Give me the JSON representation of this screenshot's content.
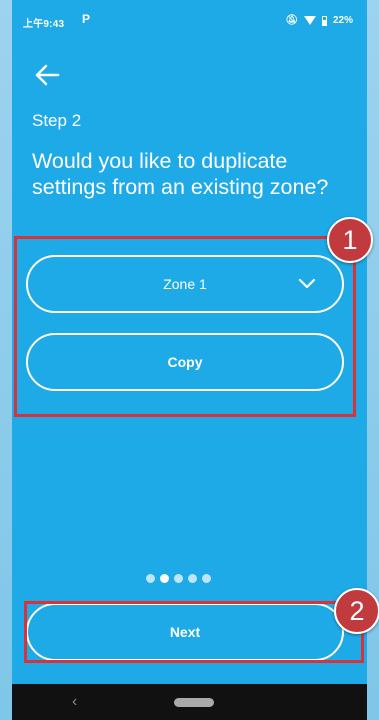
{
  "status": {
    "time": "上午9:43",
    "app_icon": "P",
    "battery": "22%",
    "icons": [
      "mute-icon",
      "wifi-icon",
      "battery-icon"
    ]
  },
  "header": {
    "back_icon": "arrow-left-icon"
  },
  "content": {
    "step": "Step 2",
    "question": "Would you like to duplicate settings from an existing zone?",
    "zone_select": {
      "value": "Zone 1",
      "icon": "chevron-down-icon"
    },
    "copy_label": "Copy"
  },
  "pager": {
    "total": 5,
    "active": 1
  },
  "footer": {
    "next_label": "Next"
  },
  "annotations": {
    "badge1": "1",
    "badge2": "2",
    "color": "#d8323a"
  },
  "colors": {
    "background": "#1eaae7",
    "text": "#ffffff"
  }
}
